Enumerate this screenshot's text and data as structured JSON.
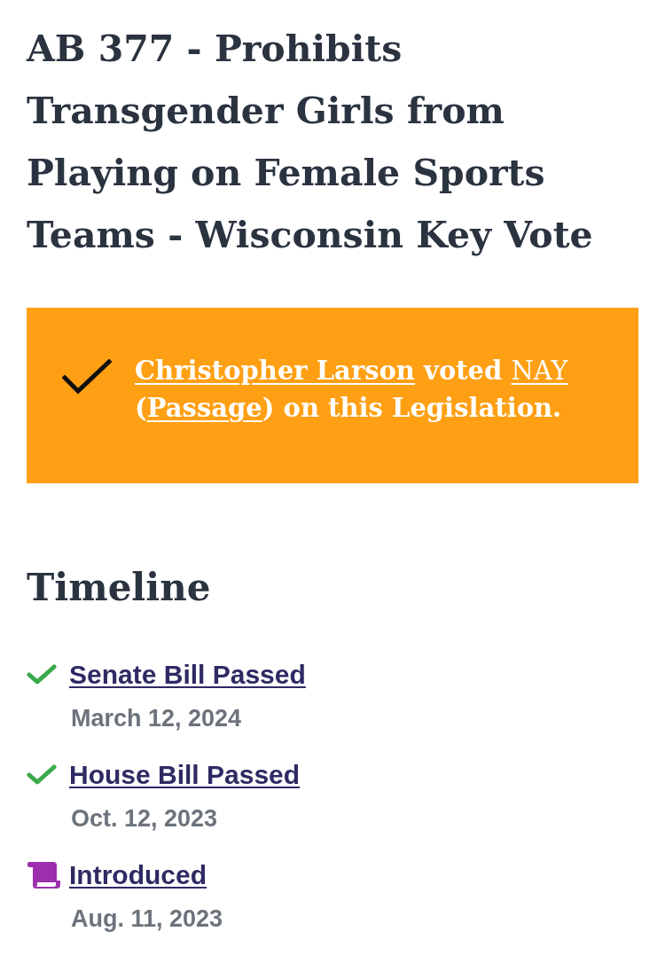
{
  "title": "AB 377 - Prohibits Transgender Girls from Playing on Female Sports Teams - Wisconsin Key Vote",
  "vote_banner": {
    "checked": true,
    "segments": [
      {
        "kind": "link",
        "text": "Christopher Larson",
        "bold": true
      },
      {
        "kind": "text",
        "text": " voted "
      },
      {
        "kind": "link",
        "text": "NAY",
        "bold": false
      },
      {
        "kind": "text",
        "text": " ("
      },
      {
        "kind": "link",
        "text": "Passage",
        "bold": true
      },
      {
        "kind": "text",
        "text": ") on this Legislation."
      }
    ]
  },
  "timeline": {
    "heading": "Timeline",
    "items": [
      {
        "kind": "passed",
        "label": "Senate Bill Passed",
        "date": "March 12, 2024"
      },
      {
        "kind": "passed",
        "label": "House Bill Passed",
        "date": "Oct. 12, 2023"
      },
      {
        "kind": "introduced",
        "label": "Introduced",
        "date": "Aug. 11, 2023"
      }
    ]
  }
}
